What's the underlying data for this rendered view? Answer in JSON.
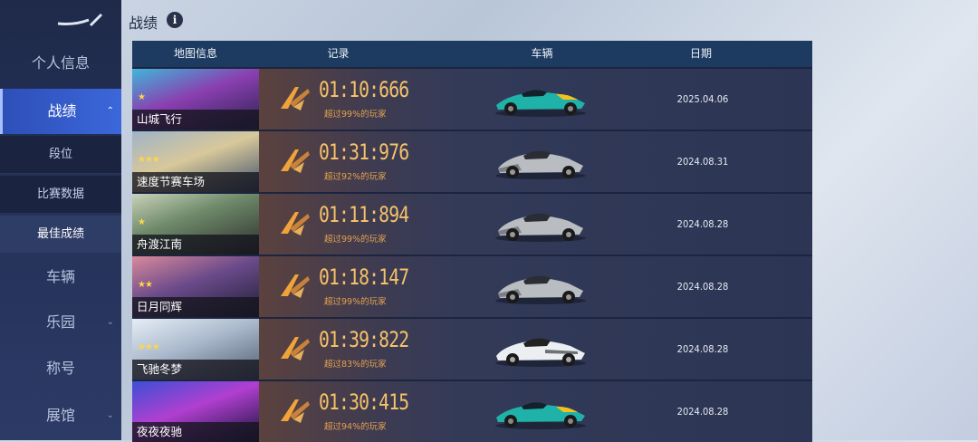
{
  "header": {
    "title": "战绩",
    "info_icon": "info-icon"
  },
  "sidebar": {
    "logo": "logo-icon",
    "main_items": [
      {
        "label": "个人信息",
        "en": ""
      },
      {
        "label": "战绩",
        "en": ""
      },
      {
        "label": "车辆",
        "en": ""
      },
      {
        "label": "乐园",
        "en": ""
      },
      {
        "label": "称号",
        "en": ""
      },
      {
        "label": "展馆",
        "en": ""
      }
    ],
    "sub_items": [
      {
        "label": "段位"
      },
      {
        "label": "比赛数据"
      },
      {
        "label": "最佳成绩"
      }
    ]
  },
  "table": {
    "columns": [
      "地图信息",
      "记录",
      "车辆",
      "日期"
    ],
    "rows": [
      {
        "map": "山城飞行",
        "time": "01:10:666",
        "pct": "超过99%的玩家",
        "car": "teal-racer",
        "date": "2025.04.06",
        "stars": 1
      },
      {
        "map": "速度节赛车场",
        "time": "01:31:976",
        "pct": "超过92%的玩家",
        "car": "silver-hypercar",
        "date": "2024.08.31",
        "stars": 3
      },
      {
        "map": "舟渡江南",
        "time": "01:11:894",
        "pct": "超过99%的玩家",
        "car": "silver-hypercar",
        "date": "2024.08.28",
        "stars": 1
      },
      {
        "map": "日月同辉",
        "time": "01:18:147",
        "pct": "超过99%的玩家",
        "car": "silver-hypercar",
        "date": "2024.08.28",
        "stars": 2
      },
      {
        "map": "飞驰冬梦",
        "time": "01:39:822",
        "pct": "超过83%的玩家",
        "car": "white-hypercar",
        "date": "2024.08.28",
        "stars": 3
      },
      {
        "map": "夜夜夜驰",
        "time": "01:30:415",
        "pct": "超过94%的玩家",
        "car": "teal-racer",
        "date": "2024.08.28",
        "stars": 0
      }
    ]
  },
  "colors": {
    "accent": "#3c67da",
    "time": "#f6c26a",
    "header_bg": "#1d3b60"
  }
}
